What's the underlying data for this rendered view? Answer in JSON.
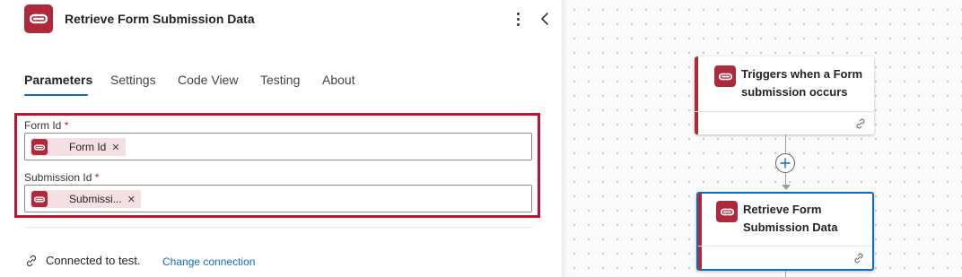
{
  "header": {
    "title": "Retrieve Form Submission Data",
    "logo_icon": "connector-logo-icon",
    "more_icon": "more-vertical-icon",
    "collapse_icon": "chevron-left-icon"
  },
  "tabs": [
    {
      "label": "Parameters",
      "active": true
    },
    {
      "label": "Settings",
      "active": false
    },
    {
      "label": "Code View",
      "active": false
    },
    {
      "label": "Testing",
      "active": false
    },
    {
      "label": "About",
      "active": false
    }
  ],
  "fields": [
    {
      "label": "Form Id",
      "required_mark": "*",
      "token": "Form Id"
    },
    {
      "label": "Submission Id",
      "required_mark": "*",
      "token": "Submissi..."
    }
  ],
  "connection": {
    "status": "Connected to test.",
    "link": "Change connection"
  },
  "canvas": {
    "cards": [
      {
        "title": "Triggers when a Form submission occurs",
        "selected": false
      },
      {
        "title": "Retrieve Form Submission Data",
        "selected": true
      }
    ]
  },
  "colors": {
    "brand": "#b0293a",
    "accent": "#0f6cbd",
    "highlight": "#c50f2f"
  }
}
